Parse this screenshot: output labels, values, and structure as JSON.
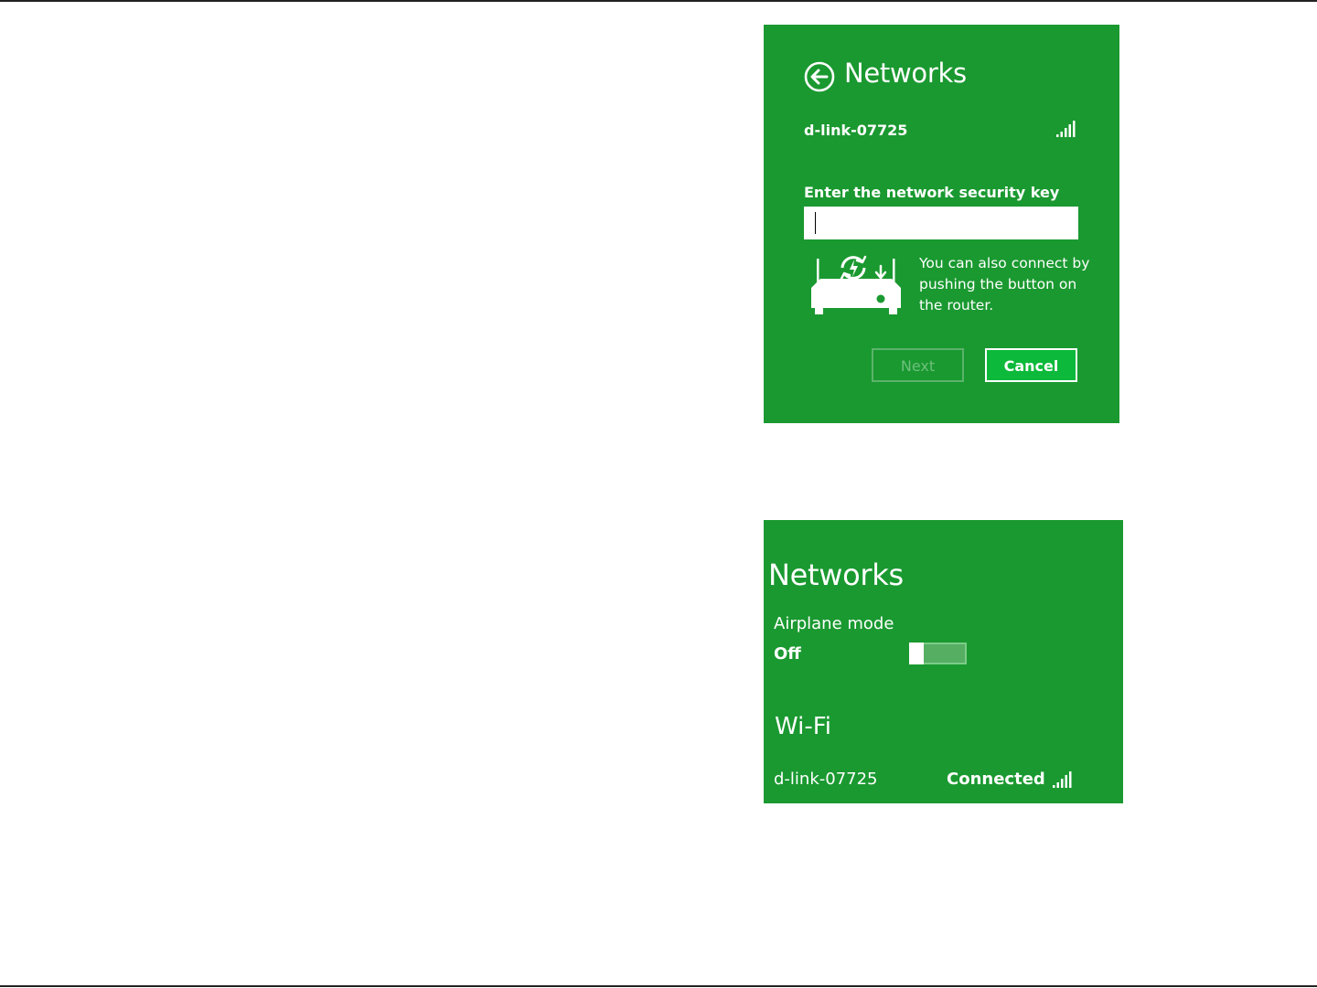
{
  "connect_panel": {
    "title": "Networks",
    "network_name": "d-link-07725",
    "security_key_label": "Enter the network security key",
    "security_key_value": "",
    "wps_hint": "You can also connect by pushing the button on the router.",
    "next_label": "Next",
    "cancel_label": "Cancel",
    "icons": [
      "back-arrow-icon",
      "signal-strength-icon",
      "wps-router-icon"
    ]
  },
  "status_panel": {
    "title": "Networks",
    "airplane_mode_label": "Airplane mode",
    "airplane_mode_state": "Off",
    "wifi_heading": "Wi-Fi",
    "network_name": "d-link-07725",
    "connection_status": "Connected",
    "icons": [
      "toggle-switch",
      "signal-strength-icon"
    ]
  },
  "colors": {
    "panel_background": "#1a9930",
    "cancel_button": "#0cb93a",
    "text": "#ffffff"
  }
}
